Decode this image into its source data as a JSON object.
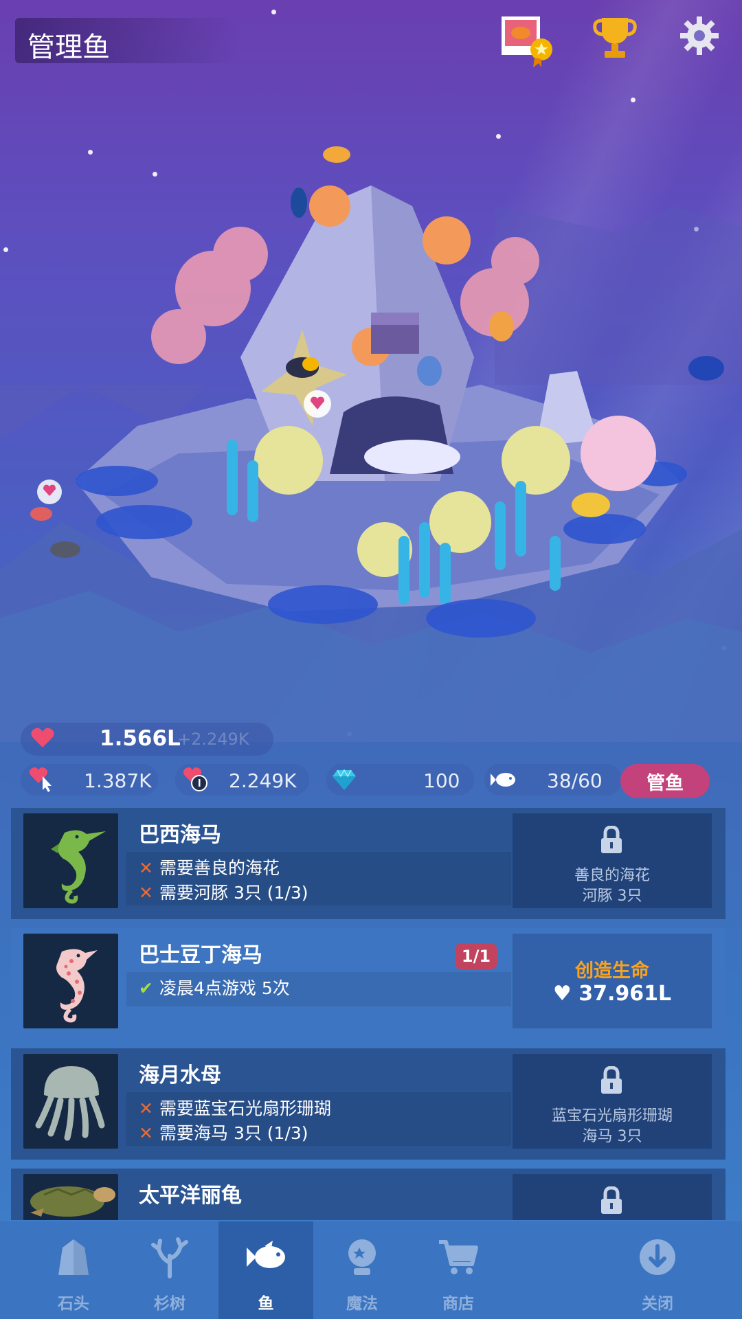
{
  "header": {
    "title": "管理鱼"
  },
  "stats": {
    "love": "1.566L",
    "love_rate": "+2.249K",
    "tap_love": "1.387K",
    "love_per_second": "2.249K",
    "gems": "100",
    "fish_count": "38/60",
    "manage_button": "管鱼"
  },
  "fish_list": [
    {
      "name": "巴西海马",
      "requirements": [
        {
          "met": false,
          "text": "需要善良的海花"
        },
        {
          "met": false,
          "text": "需要河豚 3只 (1/3)"
        }
      ],
      "locked": true,
      "unlock_line1": "善良的海花",
      "unlock_line2": "河豚 3只",
      "icon": "seahorse-green"
    },
    {
      "name": "巴士豆丁海马",
      "count": "1/1",
      "requirements": [
        {
          "met": true,
          "text": "凌晨4点游戏 5次"
        }
      ],
      "locked": false,
      "create_label": "创造生命",
      "create_cost": "37.961L",
      "icon": "seahorse-pink"
    },
    {
      "name": "海月水母",
      "requirements": [
        {
          "met": false,
          "text": "需要蓝宝石光扇形珊瑚"
        },
        {
          "met": false,
          "text": "需要海马 3只 (1/3)"
        }
      ],
      "locked": true,
      "unlock_line1": "蓝宝石光扇形珊瑚",
      "unlock_line2": "海马 3只",
      "icon": "jellyfish"
    },
    {
      "name": "太平洋丽龟",
      "requirements": [],
      "locked": true,
      "unlock_line1": "",
      "unlock_line2": "",
      "icon": "turtle"
    }
  ],
  "nav": [
    {
      "label": "石头",
      "icon": "rock-icon",
      "selected": false
    },
    {
      "label": "杉树",
      "icon": "coral-icon",
      "selected": false
    },
    {
      "label": "鱼",
      "icon": "fish-icon",
      "selected": true
    },
    {
      "label": "魔法",
      "icon": "magic-orb-icon",
      "selected": false
    },
    {
      "label": "商店",
      "icon": "cart-icon",
      "selected": false
    },
    {
      "label": "关闭",
      "icon": "close-down-icon",
      "selected": false
    }
  ],
  "colors": {
    "accent": "#c4427b",
    "create_text": "#f7a321",
    "cross": "#f06a2d",
    "check": "#a4e03d"
  }
}
